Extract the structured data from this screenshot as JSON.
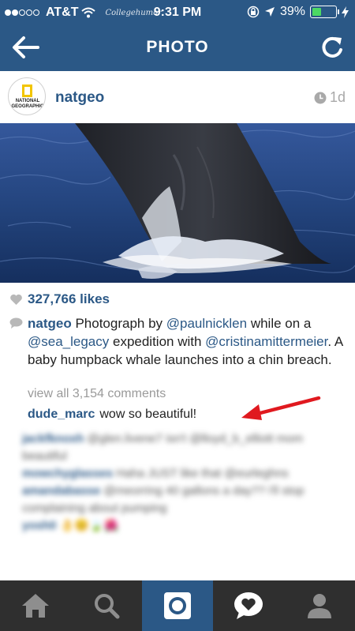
{
  "status_bar": {
    "carrier": "AT&T",
    "watermark": "Collegehumor",
    "time": "9:31 PM",
    "battery": "39%",
    "battery_level": 0.39
  },
  "nav": {
    "title": "PHOTO",
    "back_icon": "back-arrow-icon",
    "refresh_icon": "refresh-icon"
  },
  "post": {
    "avatar_text": "NATIONAL GEOGRAPHIC",
    "username": "natgeo",
    "age": "1d",
    "likes": "327,766 likes",
    "caption": {
      "user": "natgeo",
      "t1": " Photograph by ",
      "m1": "@paulnicklen",
      "t2": " while on a ",
      "m2": "@sea_legacy",
      "t3": " expedition with ",
      "m3": "@cristinamittermeier",
      "t4": ".  A baby humpback whale launches into a chin breach."
    },
    "view_all": "view all 3,154 comments",
    "comment": {
      "user": "dude_marc",
      "text": "wow so beautiful!"
    }
  },
  "blurred_comments": [
    {
      "user": "jackfknoxh",
      "text": " @glen.livene7 isn't @lloyd_b_elliott mom beautiful"
    },
    {
      "user": "mowchyglasses",
      "text": " Haha JUST like that @eurleghns"
    },
    {
      "user": "amandabasse",
      "text": " @meorring 40 gallons a day?? i'll stop complaining about pumping"
    },
    {
      "user": "yosh0",
      "text": " 👌😊🍃🌺"
    }
  ],
  "tabbar": {
    "items": [
      "home-icon",
      "search-icon",
      "camera-icon",
      "activity-icon",
      "profile-icon"
    ],
    "active_index": 2
  },
  "colors": {
    "brand": "#2b5886",
    "tabbar_bg": "#2f2f2f",
    "annotation_arrow": "#e0191f"
  }
}
